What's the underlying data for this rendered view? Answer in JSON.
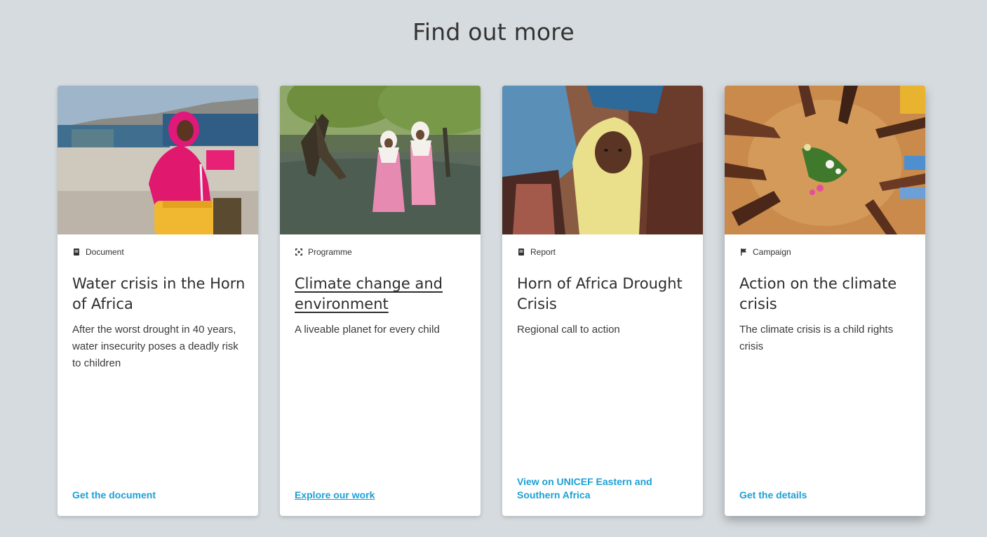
{
  "section": {
    "title": "Find out more"
  },
  "cards": [
    {
      "type_label": "Document",
      "type_icon": "document-icon",
      "title": "Water crisis in the Horn of Africa",
      "description": "After the worst drought in 40 years, water insecurity poses a deadly risk to children",
      "link": "Get the document",
      "image": "photo-woman-water-container"
    },
    {
      "type_label": "Programme",
      "type_icon": "programme-icon",
      "title": "Climate change and environment",
      "description": "A liveable planet for every child",
      "link": "Explore our work",
      "image": "photo-girls-flooded-forest"
    },
    {
      "type_label": "Report",
      "type_icon": "report-icon",
      "title": "Horn of Africa Drought Crisis",
      "description": "Regional call to action",
      "link": "View on UNICEF Eastern and Southern Africa",
      "image": "photo-child-yellow-headscarf"
    },
    {
      "type_label": "Campaign",
      "type_icon": "flag-icon",
      "title": "Action on the climate crisis",
      "description": "The climate crisis is a child rights crisis",
      "link": "Get the details",
      "image": "photo-hands-around-plant"
    }
  ],
  "colors": {
    "background": "#d5dbdf",
    "link": "#1ca0d5",
    "card": "#ffffff"
  }
}
